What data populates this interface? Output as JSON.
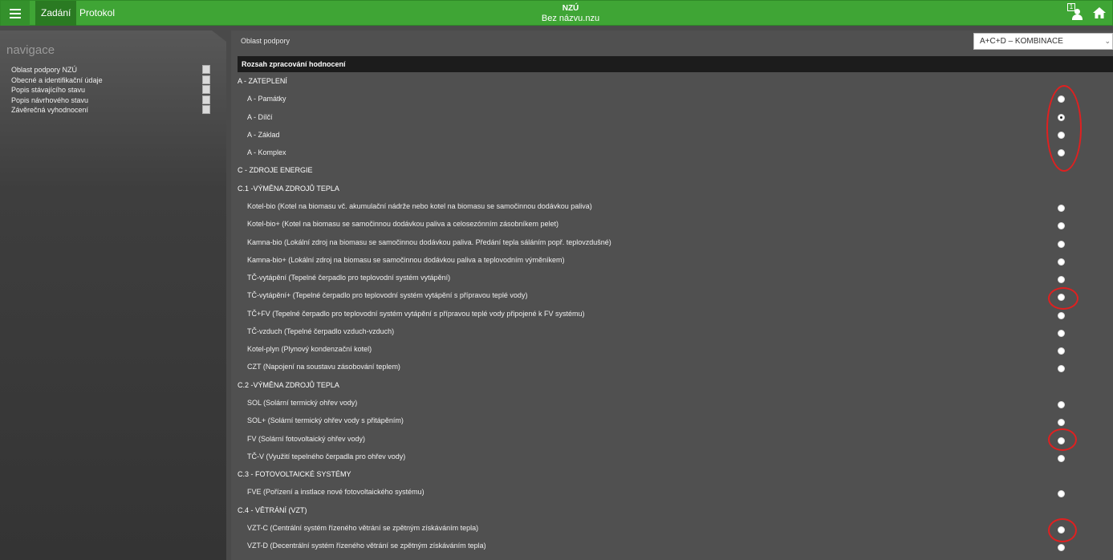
{
  "topbar": {
    "tabs": [
      "Zadání",
      "Protokol"
    ],
    "title": "NZÚ",
    "subtitle": "Bez názvu.nzu",
    "user_badge": "1",
    "icons": [
      "menu-icon",
      "user-icon",
      "home-icon"
    ]
  },
  "sidebar": {
    "title": "navigace",
    "items": [
      "Oblast podpory NZÚ",
      "Obecné a identifikační údaje",
      "Popis stávajícího stavu",
      "Popis návrhového stavu",
      "Závěrečná vyhodnocení"
    ]
  },
  "main": {
    "area_label": "Oblast podpory",
    "area_value": "A+C+D – KOMBINACE",
    "section_header": "Rozsah zpracování hodnocení",
    "rows": [
      {
        "type": "group",
        "label": "A - ZATEPLENÍ"
      },
      {
        "type": "opt",
        "label": "A - Památky",
        "checked": false
      },
      {
        "type": "opt",
        "label": "A - Dílčí",
        "checked": true
      },
      {
        "type": "opt",
        "label": "A - Základ",
        "checked": false
      },
      {
        "type": "opt",
        "label": "A - Komplex",
        "checked": false
      },
      {
        "type": "group",
        "label": "C - ZDROJE ENERGIE"
      },
      {
        "type": "group",
        "label": "C.1 -VÝMĚNA ZDROJŮ TEPLA"
      },
      {
        "type": "opt",
        "label": "Kotel-bio (Kotel na biomasu vč. akumulační nádrže nebo kotel na biomasu se samočinnou dodávkou paliva)",
        "checked": false
      },
      {
        "type": "opt",
        "label": "Kotel-bio+ (Kotel na biomasu se samočinnou dodávkou paliva a celosezónním zásobníkem pelet)",
        "checked": false
      },
      {
        "type": "opt",
        "label": "Kamna-bio (Lokální zdroj na biomasu se samočinnou dodávkou paliva. Předání tepla sáláním popř. teplovzdušné)",
        "checked": false
      },
      {
        "type": "opt",
        "label": "Kamna-bio+ (Lokální zdroj na biomasu se samočinnou dodávkou paliva a teplovodním výměníkem)",
        "checked": false
      },
      {
        "type": "opt",
        "label": "TČ-vytápění (Tepelné čerpadlo pro teplovodní systém vytápění)",
        "checked": false
      },
      {
        "type": "opt",
        "label": "TČ-vytápění+ (Tepelné čerpadlo pro teplovodní systém vytápění s přípravou teplé vody)",
        "checked": false
      },
      {
        "type": "opt",
        "label": "TČ+FV (Tepelné čerpadlo pro teplovodní systém vytápění s přípravou teplé vody připojené k FV systému)",
        "checked": false
      },
      {
        "type": "opt",
        "label": "TČ-vzduch (Tepelné čerpadlo vzduch-vzduch)",
        "checked": false
      },
      {
        "type": "opt",
        "label": "Kotel-plyn (Plynový kondenzační kotel)",
        "checked": false
      },
      {
        "type": "opt",
        "label": "CZT (Napojení na soustavu zásobování teplem)",
        "checked": false
      },
      {
        "type": "group",
        "label": "C.2 -VÝMĚNA ZDROJŮ TEPLA"
      },
      {
        "type": "opt",
        "label": "SOL (Solární termický ohřev vody)",
        "checked": false
      },
      {
        "type": "opt",
        "label": "SOL+ (Solární termický ohřev vody s přitápěním)",
        "checked": false
      },
      {
        "type": "opt",
        "label": "FV (Solární fotovoltaický ohřev vody)",
        "checked": false
      },
      {
        "type": "opt",
        "label": "TČ-V (Využití tepelného čerpadla pro ohřev vody)",
        "checked": false
      },
      {
        "type": "group",
        "label": "C.3 - FOTOVOLTAICKÉ SYSTÉMY"
      },
      {
        "type": "opt",
        "label": "FVE (Pořízení a instlace nové fotovoltaického systému)",
        "checked": false
      },
      {
        "type": "group",
        "label": "C.4 - VĚTRÁNÍ (VZT)"
      },
      {
        "type": "opt",
        "label": "VZT-C (Centrální systém řízeného větrání se zpětným získáváním tepla)",
        "checked": false
      },
      {
        "type": "opt",
        "label": "VZT-D (Decentrální systém řízeného větrání se zpětným získáváním tepla)",
        "checked": false
      }
    ]
  },
  "colors": {
    "topbar": "#3fa535",
    "active_tab": "#2a7a22",
    "panel": "#505050",
    "header_band": "#1c1c1c",
    "annotation": "#e02020"
  }
}
